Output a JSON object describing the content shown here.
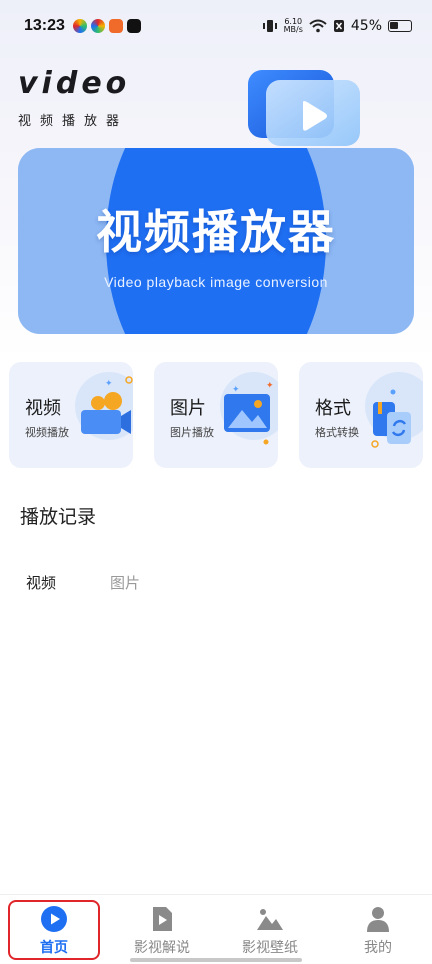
{
  "status": {
    "time": "13:23",
    "net_speed_value": "6.10",
    "net_speed_unit": "MB/s",
    "battery": "45%"
  },
  "brand": {
    "logo": "video",
    "subtitle": "视频播放器"
  },
  "banner": {
    "title": "视频播放器",
    "subtitle": "Video playback image conversion"
  },
  "cards": [
    {
      "title": "视频",
      "subtitle": "视频播放"
    },
    {
      "title": "图片",
      "subtitle": "图片播放"
    },
    {
      "title": "格式",
      "subtitle": "格式转换"
    }
  ],
  "history": {
    "title": "播放记录",
    "tabs": [
      "视频",
      "图片"
    ]
  },
  "nav": {
    "items": [
      "首页",
      "影视解说",
      "影视壁纸",
      "我的"
    ],
    "active": "首页"
  },
  "colors": {
    "accent": "#1f6ff3",
    "inactive": "#888888",
    "highlight": "#e0262b",
    "card_bg": "#edf1fb"
  }
}
